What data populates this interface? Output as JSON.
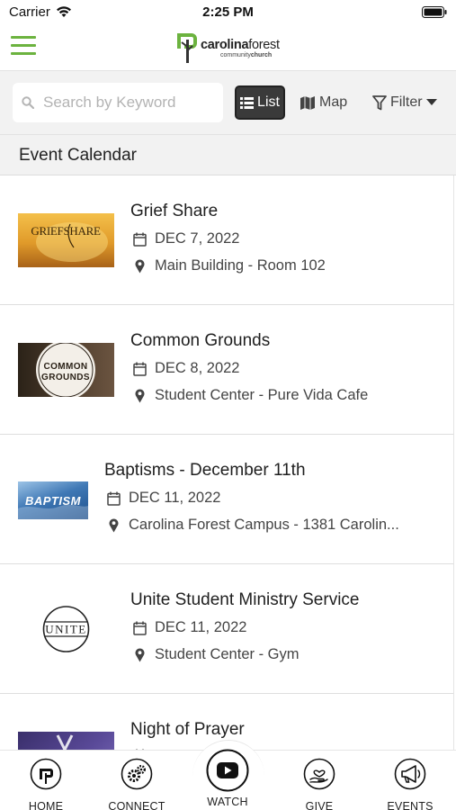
{
  "status_bar": {
    "carrier": "Carrier",
    "time": "2:25 PM"
  },
  "header": {
    "logo_main": "carolina",
    "logo_main_bold": "forest",
    "logo_sub": "community",
    "logo_sub_bold": "church"
  },
  "toolbar": {
    "search_placeholder": "Search by Keyword",
    "list_label": "List",
    "map_label": "Map",
    "filter_label": "Filter"
  },
  "section": {
    "title": "Event Calendar"
  },
  "events": [
    {
      "title": "Grief Share",
      "date": "DEC 7, 2022",
      "location": "Main Building - Room 102",
      "thumb_text": "GRIEFSHARE"
    },
    {
      "title": "Common Grounds",
      "date": "DEC 8, 2022",
      "location": "Student Center - Pure Vida Cafe",
      "thumb_text": "COMMON GROUNDS"
    },
    {
      "title": "Baptisms - December 11th",
      "date": "DEC 11, 2022",
      "location": "Carolina Forest Campus - 1381 Carolin...",
      "thumb_text": "BAPTISM"
    },
    {
      "title": "Unite Student Ministry Service",
      "date": "DEC 11, 2022",
      "location": "Student Center - Gym",
      "thumb_text": "UNITE"
    },
    {
      "title": "Night of Prayer",
      "date": "",
      "location": "",
      "thumb_text": ""
    }
  ],
  "tabs": [
    {
      "label": "HOME",
      "icon": "home-icon"
    },
    {
      "label": "CONNECT",
      "icon": "gears-icon"
    },
    {
      "label": "WATCH",
      "icon": "youtube-icon"
    },
    {
      "label": "GIVE",
      "icon": "hand-heart-icon"
    },
    {
      "label": "EVENTS",
      "icon": "megaphone-icon"
    }
  ],
  "colors": {
    "accent_green": "#6cb33f",
    "button_dark": "#3a3a3a",
    "toolbar_bg": "#f2f2f2"
  }
}
